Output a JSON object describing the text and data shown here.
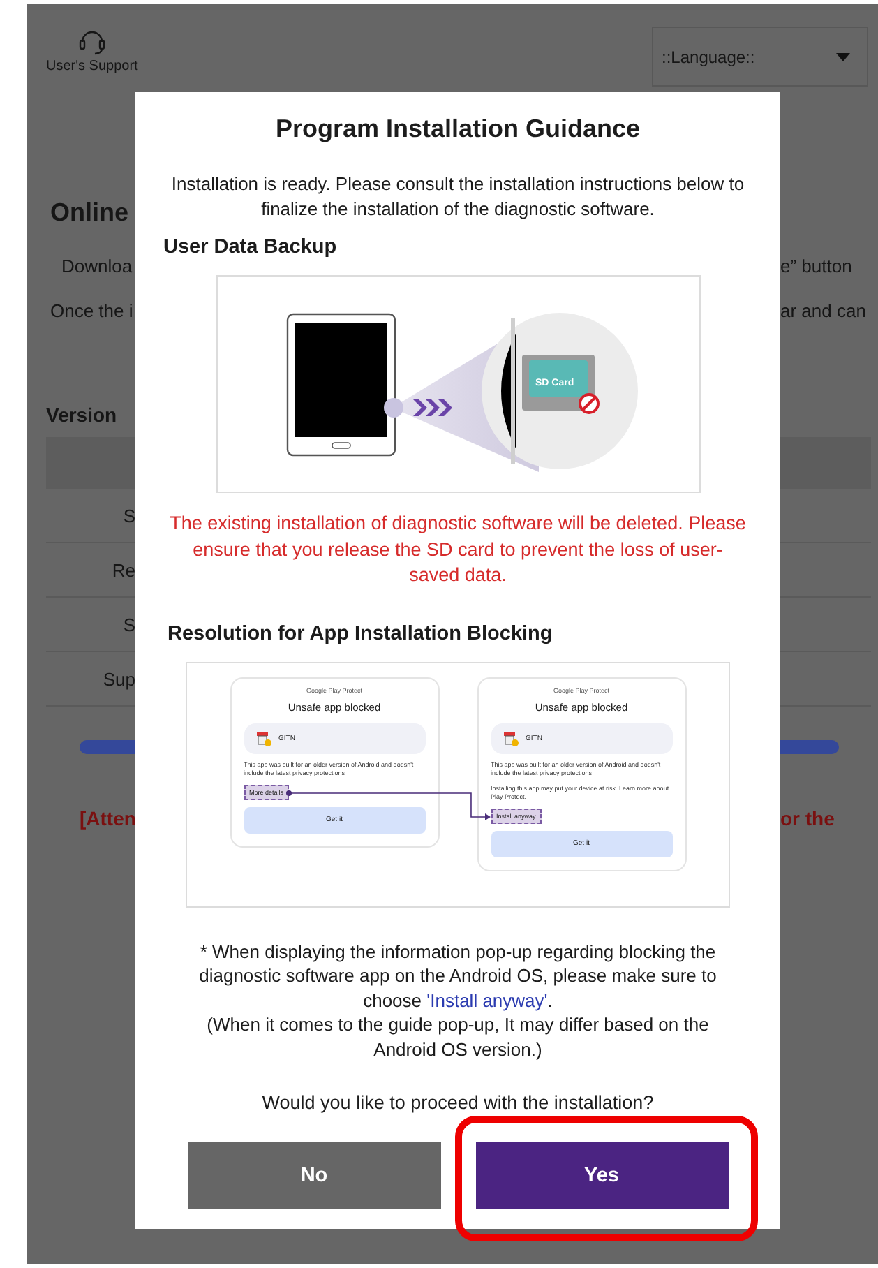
{
  "background": {
    "support_label": "User's Support",
    "language_select": {
      "value": "::Language::"
    },
    "heading": "Online",
    "lines": [
      {
        "left": "Downloa",
        "right": "e” button"
      },
      {
        "left": "Once the i",
        "right": "ar and can"
      }
    ],
    "version_label": "Version",
    "table_rows": [
      "S",
      "Re",
      "S",
      "Sup"
    ],
    "attention": {
      "left": "[Atten",
      "right": "or the"
    }
  },
  "dialog": {
    "title": "Program Installation Guidance",
    "intro": "Installation is ready. Please consult the installation instructions below to finalize the installation of the diagnostic software.",
    "backup_heading": "User Data Backup",
    "sd_label": "SD Card",
    "warning": "The existing installation of diagnostic software will be deleted. Please ensure that you release the SD card to prevent the loss of user-saved data.",
    "blocking_heading": "Resolution for App Installation Blocking",
    "panels": [
      {
        "source": "Google Play Protect",
        "title": "Unsafe app blocked",
        "app": "GITN",
        "paragraphs": [
          "This app was built for an older version of Android and doesn't include the latest privacy protections"
        ],
        "action": "More details",
        "button": "Get it"
      },
      {
        "source": "Google Play Protect",
        "title": "Unsafe app blocked",
        "app": "GITN",
        "paragraphs": [
          "This app was built for an older version of Android and doesn't include the latest privacy protections",
          "Installing this app may put your device at risk. Learn more about Play Protect."
        ],
        "action": "Install anyway",
        "button": "Get it"
      }
    ],
    "note": {
      "before": "* When displaying the information pop-up regarding blocking the diagnostic software app on the Android OS, please make sure to choose ",
      "link": "'Install anyway'",
      "after": "."
    },
    "note_extra": "(When it comes to the guide pop-up, It may differ based on the Android OS version.)",
    "question": "Would you like to proceed with the installation?",
    "buttons": [
      {
        "label": "No",
        "kind": "secondary",
        "highlighted": false
      },
      {
        "label": "Yes",
        "kind": "primary",
        "highlighted": true
      }
    ]
  }
}
